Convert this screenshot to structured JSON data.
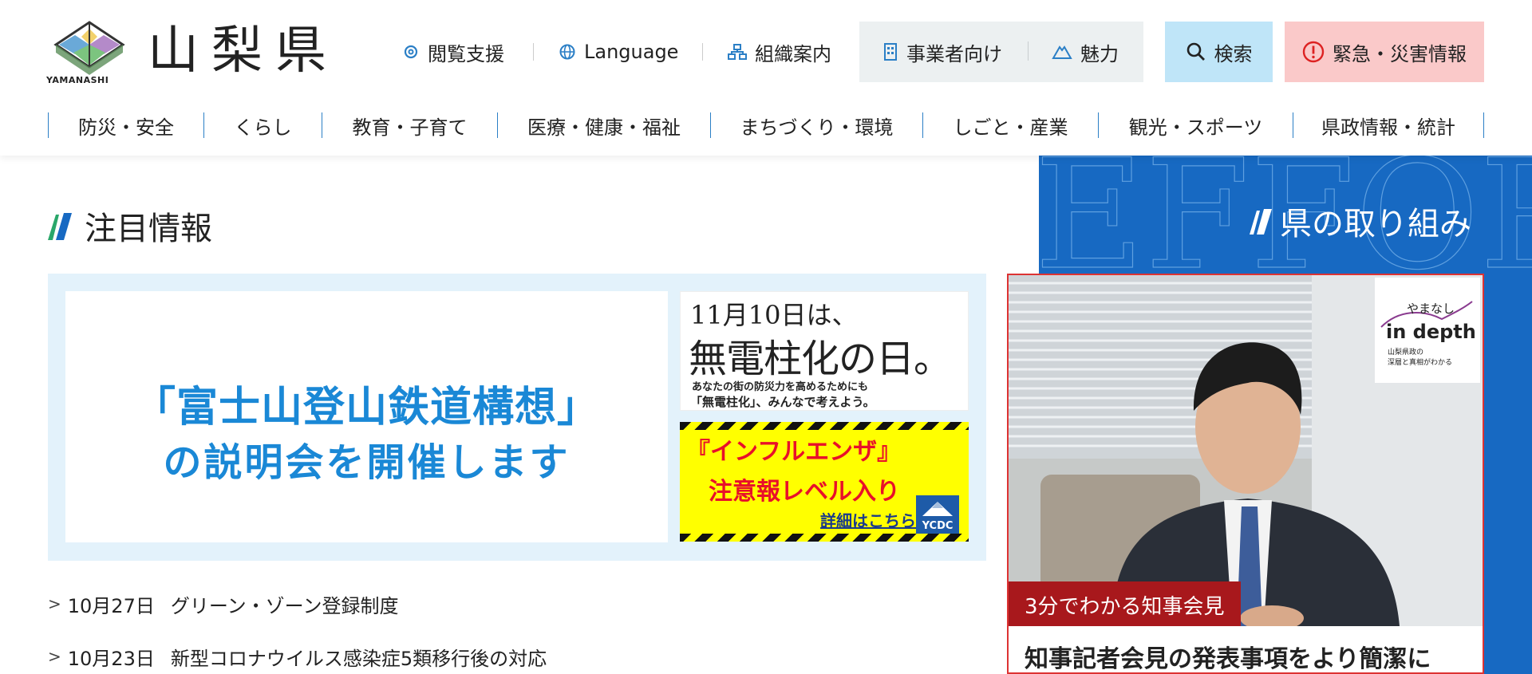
{
  "header": {
    "prefecture_name": "山梨県",
    "logo_text": "YAMANASHI",
    "utility": {
      "accessibility": "閲覧支援",
      "language": "Language",
      "organization": "組織案内",
      "business": "事業者向け",
      "attraction": "魅力",
      "search": "検索",
      "emergency": "緊急・災害情報"
    },
    "nav": [
      "防災・安全",
      "くらし",
      "教育・子育て",
      "医療・健康・福祉",
      "まちづくり・環境",
      "しごと・産業",
      "観光・スポーツ",
      "県政情報・統計"
    ]
  },
  "main": {
    "section_title": "注目情報",
    "main_banner": {
      "line1": "「富士山登山鉄道構想」",
      "line2": "の説明会を開催します"
    },
    "side_banner1": {
      "date": "11月10日は、",
      "main": "無電柱化の日。",
      "sub1": "あなたの街の防災力を高めるためにも",
      "sub2": "「無電柱化」、みんなで考えよう。"
    },
    "side_banner2": {
      "title": "『インフルエンザ』",
      "subtitle": "注意報レベル入り",
      "link": "詳細はこちら",
      "logo": "YCDC"
    },
    "news": [
      {
        "date": "10月27日",
        "title": "グリーン・ゾーン登録制度"
      },
      {
        "date": "10月23日",
        "title": "新型コロナウイルス感染症5類移行後の対応"
      }
    ]
  },
  "right": {
    "bg_word": "EFFOR",
    "title": "県の取り組み",
    "indepth": {
      "top": "やまなし",
      "main": "in depth",
      "sub1": "山梨県政の",
      "sub2": "深層と真相がわかる"
    },
    "badge": "3分でわかる知事会見",
    "caption": "知事記者会見の発表事項をより簡潔に"
  },
  "colors": {
    "accent_blue": "#1769c2",
    "nav_line": "#2b7fc6",
    "search_bg": "#bfe5f8",
    "emergency_bg": "#fac9c9",
    "badge_red": "#a8181c"
  }
}
